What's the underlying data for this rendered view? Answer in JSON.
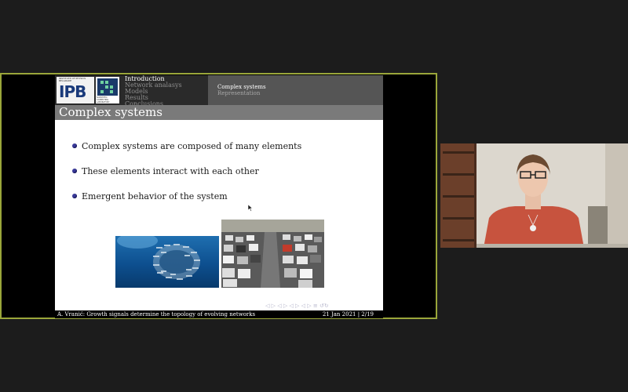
{
  "slide": {
    "logos": {
      "ipb_small_text": "INSTITUTE OF PHYSICS BELGRADE",
      "ipb_mark": "IPB",
      "scl_caption": "SCIENTIFIC COMPUTING LABORATORY"
    },
    "nav_sections": [
      {
        "label": "Introduction",
        "active": true
      },
      {
        "label": "Network analasys",
        "active": false
      },
      {
        "label": "Models",
        "active": false
      },
      {
        "label": "Results",
        "active": false
      },
      {
        "label": "Conclusions",
        "active": false
      }
    ],
    "current_section": "Complex systems",
    "current_subsection": "Representation",
    "frame_title": "Complex systems",
    "bullets": [
      "Complex systems are composed of many elements",
      "These elements interact with each other",
      "Emergent behavior of the system"
    ],
    "beamer_nav_symbols": "◁ ▷ ◁ ▷ ◁ ▷ ◁ ▷ ≡ ↺↻",
    "footer": {
      "author_title": "A. Vranić: Growth signals determine the topology of evolving networks",
      "date_page": "21 Jan 2021 | 2/19"
    }
  },
  "colors": {
    "share_border": "#9aa63a",
    "bullet": "#3a3a9a",
    "frametitle_bg": "#7a7a7a",
    "header_bg": "#2a2a2a"
  }
}
